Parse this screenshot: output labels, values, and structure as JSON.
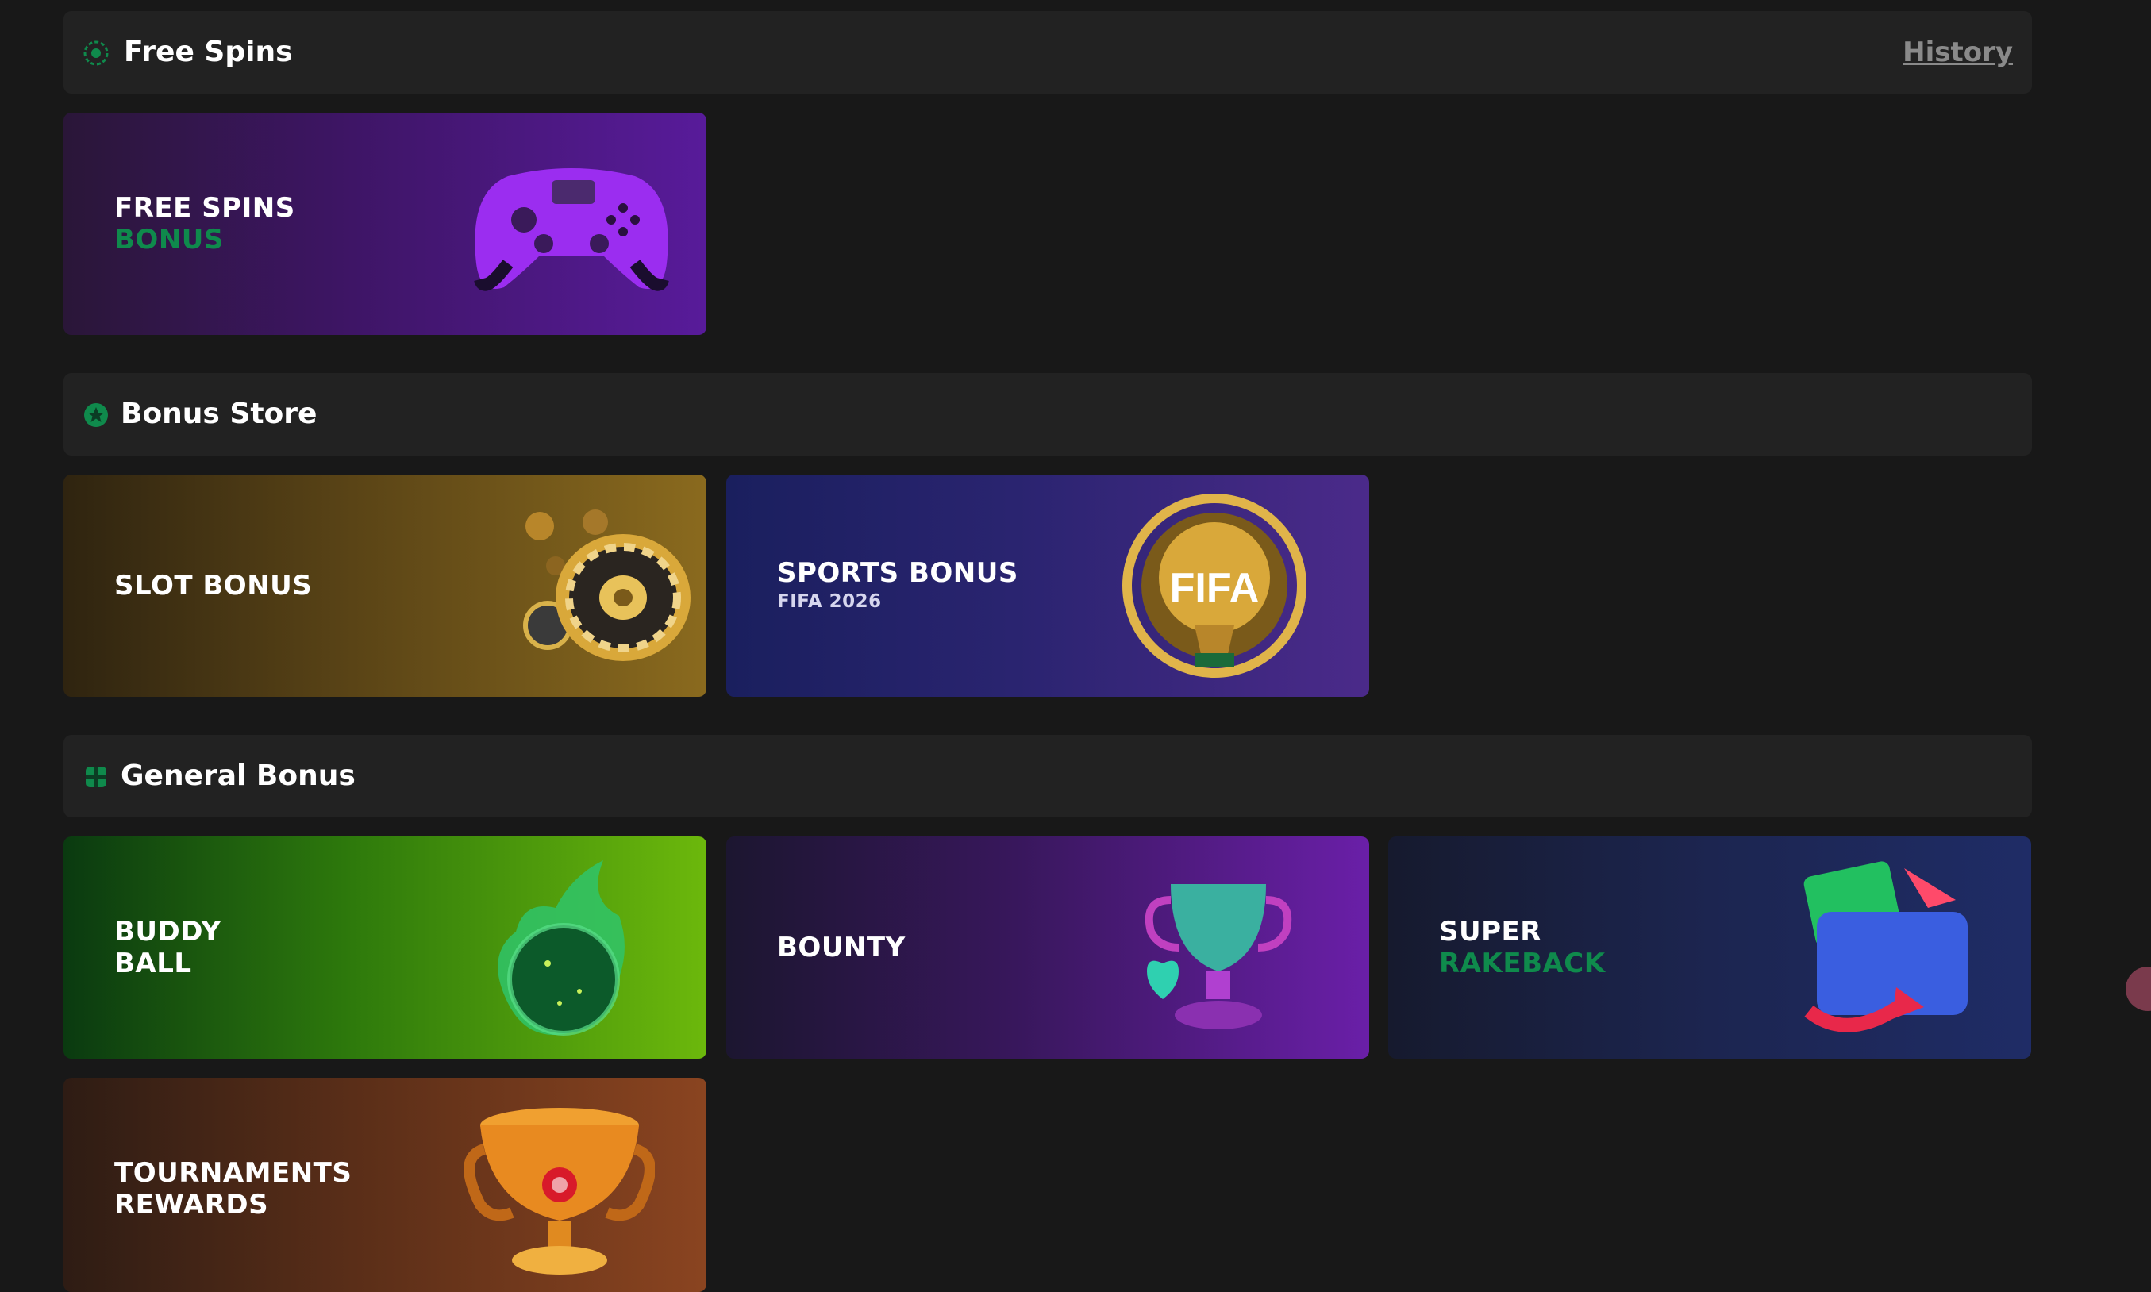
{
  "free_spins": {
    "title": "Free Spins",
    "history_label": "History",
    "cards": [
      {
        "line1": "FREE SPINS",
        "line2": "BONUS",
        "image": "purple-gamepad"
      }
    ]
  },
  "bonus_store": {
    "title": "Bonus Store",
    "cards": [
      {
        "line1": "SLOT BONUS",
        "image": "roulette-wheel-chips"
      },
      {
        "line1": "SPORTS BONUS",
        "subtitle": "FIFA 2026",
        "image": "fifa-world-cup-trophy",
        "badge_text": "FIFA"
      }
    ]
  },
  "general_bonus": {
    "title": "General Bonus",
    "cards": [
      {
        "line1": "BUDDY",
        "line2": "BALL",
        "image": "green-fire-ball"
      },
      {
        "line1": "BOUNTY",
        "image": "neon-trophy-cup"
      },
      {
        "line1": "SUPER",
        "line2": "RAKEBACK",
        "image": "wallet-with-arrows"
      },
      {
        "line1": "TOURNAMENTS",
        "line2": "REWARDS",
        "image": "orange-trophy-cup"
      }
    ]
  },
  "colors": {
    "accent_green": "#0f8a4c",
    "page_bg": "#181818",
    "header_bg": "#222222",
    "history_link": "#8a8a8a"
  }
}
